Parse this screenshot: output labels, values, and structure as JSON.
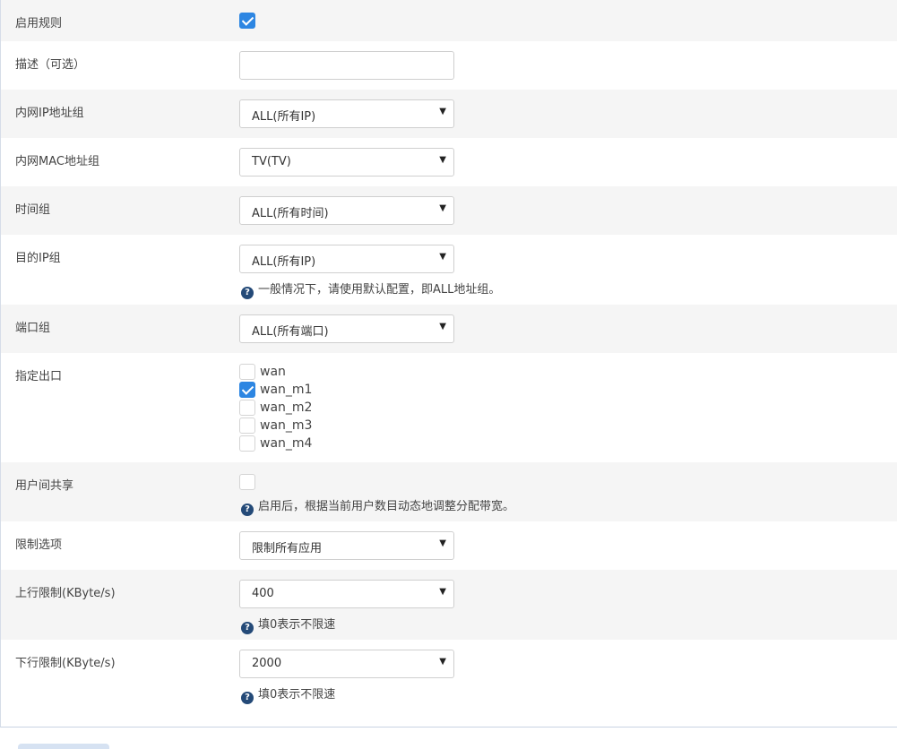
{
  "rows": {
    "enable": {
      "label": "启用规则",
      "checked": true
    },
    "description": {
      "label": "描述（可选）",
      "value": "",
      "placeholder": ""
    },
    "lan_ip_group": {
      "label": "内网IP地址组",
      "selected": "ALL(所有IP)"
    },
    "lan_mac_group": {
      "label": "内网MAC地址组",
      "selected": "TV(TV)"
    },
    "time_group": {
      "label": "时间组",
      "selected": "ALL(所有时间)"
    },
    "dest_ip_group": {
      "label": "目的IP组",
      "selected": "ALL(所有IP)",
      "hint": "一般情况下，请使用默认配置，即ALL地址组。"
    },
    "port_group": {
      "label": "端口组",
      "selected": "ALL(所有端口)"
    },
    "outlet": {
      "label": "指定出口",
      "options": [
        {
          "label": "wan",
          "checked": false
        },
        {
          "label": "wan_m1",
          "checked": true
        },
        {
          "label": "wan_m2",
          "checked": false
        },
        {
          "label": "wan_m3",
          "checked": false
        },
        {
          "label": "wan_m4",
          "checked": false
        }
      ]
    },
    "shared": {
      "label": "用户间共享",
      "checked": false,
      "hint": "启用后，根据当前用户数目动态地调整分配带宽。"
    },
    "limit_option": {
      "label": "限制选项",
      "selected": "限制所有应用"
    },
    "upload_limit": {
      "label": "上行限制(KByte/s)",
      "selected": "400",
      "hint": "填0表示不限速"
    },
    "download_limit": {
      "label": "下行限制(KByte/s)",
      "selected": "2000",
      "hint": "填0表示不限速"
    }
  },
  "icons": {
    "help": "question-circle-icon",
    "dropdown": "caret-down-icon",
    "check": "check-icon"
  },
  "colors": {
    "accent": "#2d86e2",
    "help_icon": "#244a78",
    "row_alt_bg": "#f5f5f5"
  }
}
